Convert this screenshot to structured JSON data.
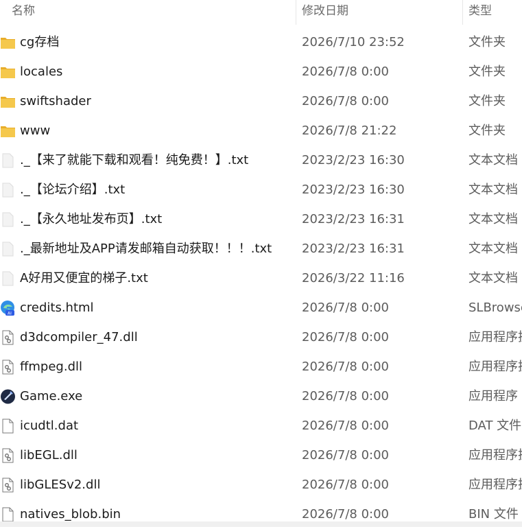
{
  "header": {
    "name": "名称",
    "date": "修改日期",
    "type": "类型"
  },
  "files": [
    {
      "name": "cg存档",
      "date": "2026/7/10 23:52",
      "type": "文件夹",
      "icon": "folder-icon"
    },
    {
      "name": "locales",
      "date": "2026/7/8 0:00",
      "type": "文件夹",
      "icon": "folder-icon"
    },
    {
      "name": "swiftshader",
      "date": "2026/7/8 0:00",
      "type": "文件夹",
      "icon": "folder-icon"
    },
    {
      "name": "www",
      "date": "2026/7/8 21:22",
      "type": "文件夹",
      "icon": "folder-icon"
    },
    {
      "name": "._【来了就能下载和观看！纯免费！】.txt",
      "date": "2023/2/23 16:30",
      "type": "文本文档",
      "icon": "text-file-icon"
    },
    {
      "name": "._【论坛介绍】.txt",
      "date": "2023/2/23 16:30",
      "type": "文本文档",
      "icon": "text-file-icon"
    },
    {
      "name": "._【永久地址发布页】.txt",
      "date": "2023/2/23 16:31",
      "type": "文本文档",
      "icon": "text-file-icon"
    },
    {
      "name": "._最新地址及APP请发邮箱自动获取！！！.txt",
      "date": "2023/2/23 16:31",
      "type": "文本文档",
      "icon": "text-file-icon"
    },
    {
      "name": "A好用又便宜的梯子.txt",
      "date": "2026/3/22 11:16",
      "type": "文本文档",
      "icon": "text-file-icon"
    },
    {
      "name": "credits.html",
      "date": "2026/7/8 0:00",
      "type": "SLBrowse",
      "icon": "browser-icon"
    },
    {
      "name": "d3dcompiler_47.dll",
      "date": "2026/7/8 0:00",
      "type": "应用程序扩",
      "icon": "dll-file-icon"
    },
    {
      "name": "ffmpeg.dll",
      "date": "2026/7/8 0:00",
      "type": "应用程序扩",
      "icon": "dll-file-icon"
    },
    {
      "name": "Game.exe",
      "date": "2026/7/8 0:00",
      "type": "应用程序",
      "icon": "game-exe-icon"
    },
    {
      "name": "icudtl.dat",
      "date": "2026/7/8 0:00",
      "type": "DAT 文件",
      "icon": "blank-file-icon"
    },
    {
      "name": "libEGL.dll",
      "date": "2026/7/8 0:00",
      "type": "应用程序扩",
      "icon": "dll-file-icon"
    },
    {
      "name": "libGLESv2.dll",
      "date": "2026/7/8 0:00",
      "type": "应用程序扩",
      "icon": "dll-file-icon"
    },
    {
      "name": "natives_blob.bin",
      "date": "2026/7/8 0:00",
      "type": "BIN 文件",
      "icon": "blank-file-icon"
    }
  ],
  "colors": {
    "folder": "#f5c84c",
    "folder_dark": "#e8ad2a",
    "header_text": "#6b6b6b",
    "date_text": "#5c5c5c",
    "browser_blue": "#1a73e8",
    "game_dark": "#1f2a44"
  }
}
